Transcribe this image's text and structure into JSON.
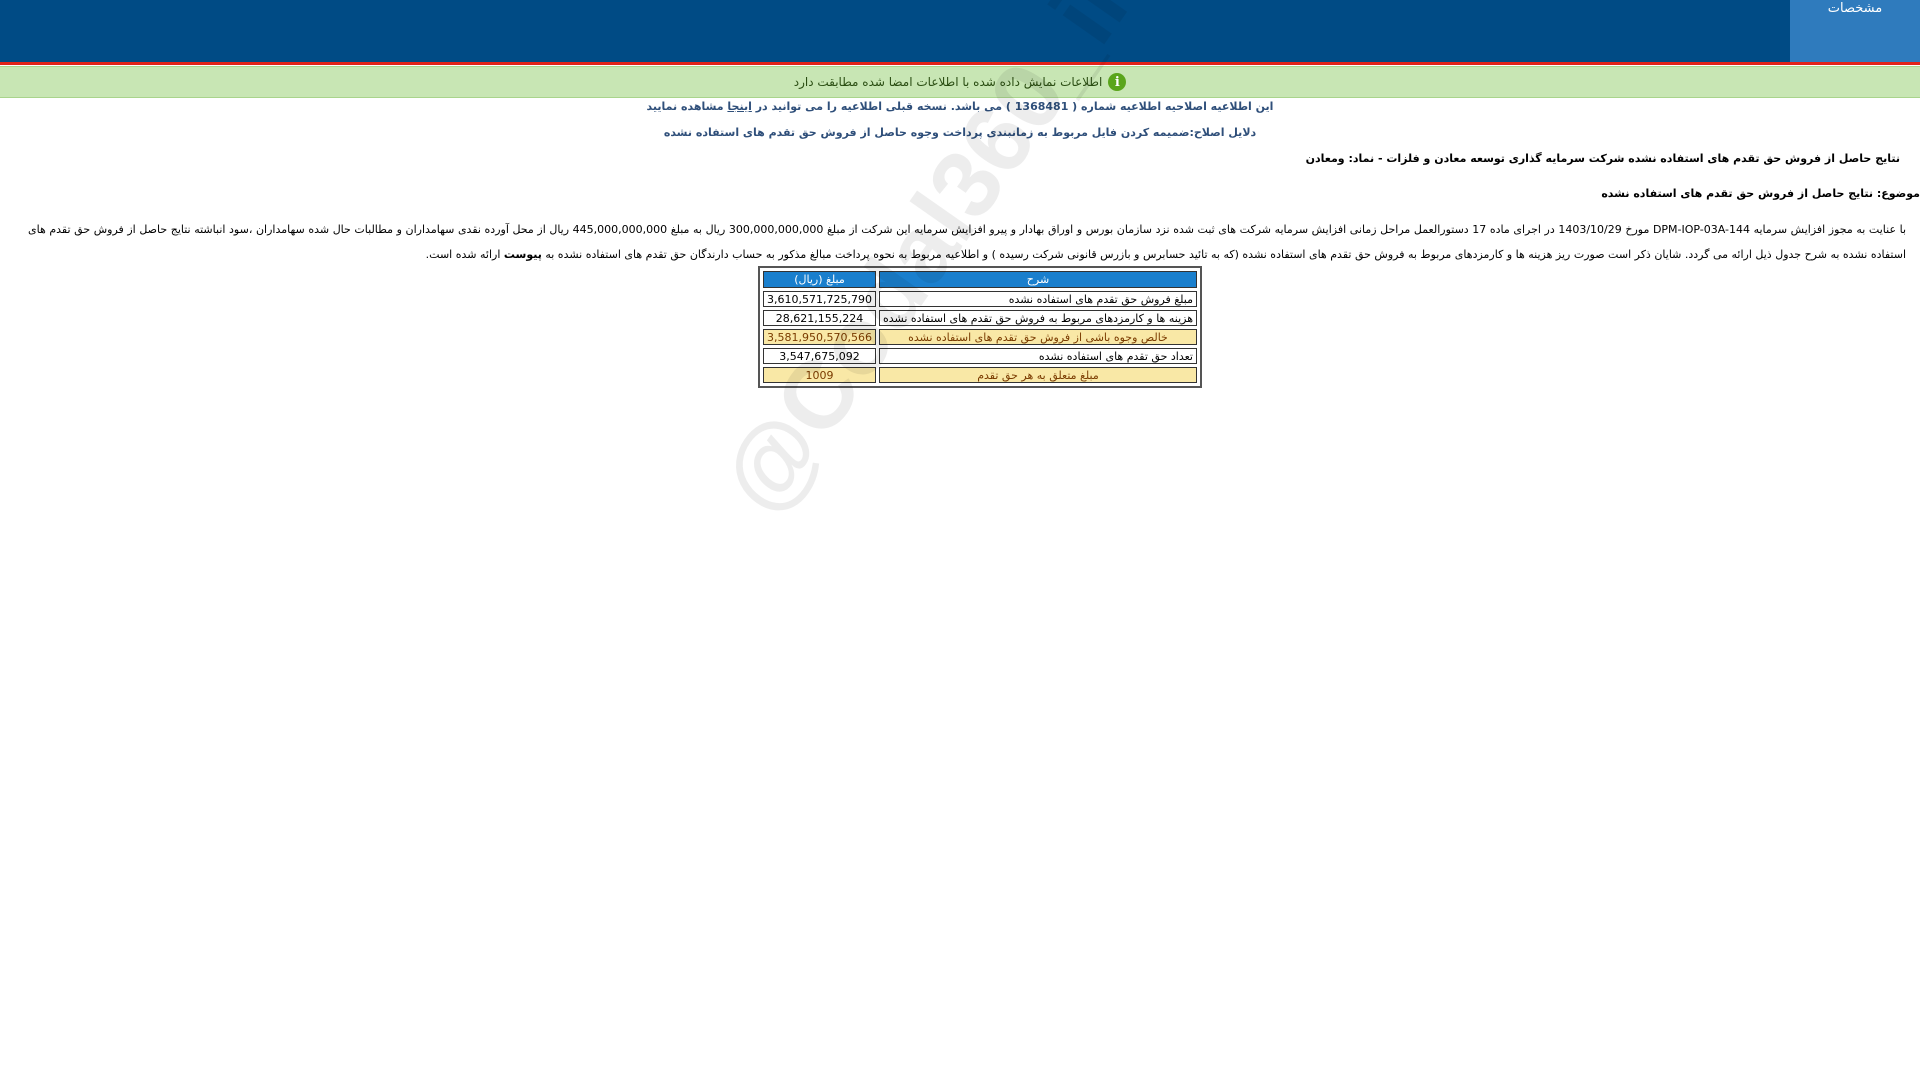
{
  "header": {
    "tab_label": "مشخصات"
  },
  "notice": {
    "text": "اطلاعات نمایش داده شده با اطلاعات امضا شده مطابقت دارد",
    "icon": "info-icon"
  },
  "correction": {
    "prefix": "این اطلاعیه اصلاحیه اطلاعیه شماره ( 1368481 ) می باشد. نسخه قبلی اطلاعیه را می توانید در ",
    "link": "اینجا",
    "suffix": " مشاهده نمایید",
    "reason": "دلایل اصلاح:ضمیمه کردن فایل مربوط به زمانبندی پرداخت وجوه حاصل از فروش حق تقدم های استفاده نشده"
  },
  "title": "نتایج حاصل از فروش حق تقدم های استفاده نشده شرکت سرمایه گذاری توسعه معادن و فلزات - نماد: ومعادن",
  "subject": "موضوع:  نتایج حاصل از فروش حق تقدم های استفاده نشده",
  "body": {
    "text1": "با عنایت به مجوز افزایش سرمایه DPM-IOP-03A-144 مورخ 1403/10/29 در اجرای ماده 17 دستورالعمل مراحل زمانی افزایش سرمایه شرکت های ثبت شده نزد سازمان بورس و اوراق بهادار و پیرو افزایش سرمایه این شرکت از مبلغ 300,000,000,000 ریال به مبلغ 445,000,000,000 ریال از محل آورده نقدی سهامداران و مطالبات حال شده سهامداران ،سود انباشته نتایج حاصل از فروش حق تقدم های استفاده نشده به شرح جدول ذیل ارائه می گردد. شایان ذکر است صورت ریز هزینه ها و کارمزدهای مربوط به فروش حق تقدم های استفاده نشده (که به تائید حسابرس و بازرس قانونی شرکت رسیده ) و اطلاعیه مربوط به نحوه پرداخت مبالغ مذکور به حساب دارندگان حق تقدم های استفاده نشده به ",
    "bold": "پیوست",
    "text2": " ارائه شده است."
  },
  "table": {
    "headers": [
      "شرح",
      "مبلغ (ریال)"
    ],
    "rows": [
      {
        "desc": "مبلغ فروش حق تقدم های استفاده نشده",
        "amount": "3,610,571,725,790"
      },
      {
        "desc": "هزینه ها و کارمزدهای مربوط به فروش حق تقدم های استفاده نشده",
        "amount": "28,621,155,224"
      },
      {
        "desc": "خالص وجوه باشی از فروش حق تقدم های استفاده نشده",
        "amount": "3,581,950,570,566"
      },
      {
        "desc": "تعداد حق تقدم های استفاده نشده",
        "amount": "3,547,675,092"
      },
      {
        "desc": "مبلغ متعلق به هر حق تقدم",
        "amount": "1009"
      }
    ]
  },
  "watermark": "@Codal360_ir",
  "colors": {
    "header_bg": "#004b85",
    "header_border": "#e2231a",
    "tab_bg": "#2f7bbd",
    "notice_bg": "#c8e6b4",
    "table_header_bg": "#1a7fcd",
    "highlight_row_bg": "#f9e8a6"
  }
}
